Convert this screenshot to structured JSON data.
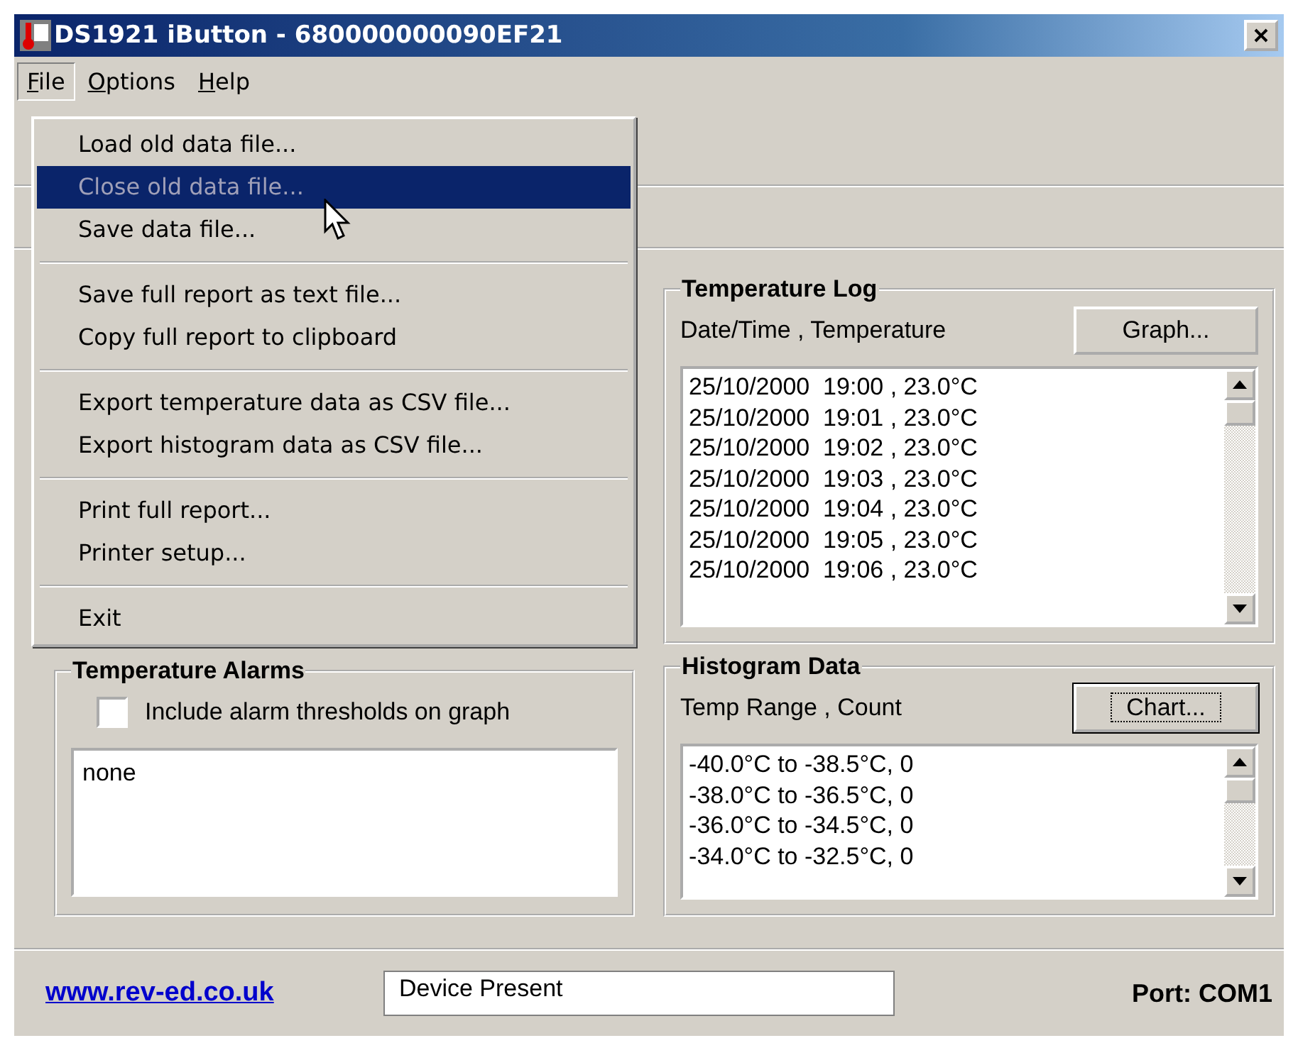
{
  "window": {
    "title": "DS1921 iButton - 680000000090EF21"
  },
  "menu_bar": [
    {
      "label": "File",
      "selected": true
    },
    {
      "label": "Options",
      "selected": false
    },
    {
      "label": "Help",
      "selected": false
    }
  ],
  "file_menu": [
    {
      "kind": "item",
      "label": "Load old data file...",
      "disabled": false,
      "selected": false
    },
    {
      "kind": "item",
      "label": "Close old data file...",
      "disabled": true,
      "selected": true
    },
    {
      "kind": "item",
      "label": "Save data file...",
      "disabled": false,
      "selected": false
    },
    {
      "kind": "separator"
    },
    {
      "kind": "item",
      "label": "Save full report as text file...",
      "disabled": false,
      "selected": false
    },
    {
      "kind": "item",
      "label": "Copy full report to clipboard",
      "disabled": false,
      "selected": false
    },
    {
      "kind": "separator"
    },
    {
      "kind": "item",
      "label": "Export temperature data as CSV file...",
      "disabled": false,
      "selected": false
    },
    {
      "kind": "item",
      "label": "Export histogram data as CSV file...",
      "disabled": false,
      "selected": false
    },
    {
      "kind": "separator"
    },
    {
      "kind": "item",
      "label": "Print full report...",
      "disabled": false,
      "selected": false
    },
    {
      "kind": "item",
      "label": "Printer setup...",
      "disabled": false,
      "selected": false
    },
    {
      "kind": "separator"
    },
    {
      "kind": "item",
      "label": "Exit",
      "disabled": false,
      "selected": false
    }
  ],
  "temperature_alarms": {
    "title": "Temperature Alarms",
    "checkbox": {
      "label": "Include alarm thresholds on graph",
      "checked": false
    },
    "text": "none"
  },
  "temperature_log": {
    "title": "Temperature Log",
    "header": "Date/Time , Temperature",
    "button": {
      "label": "Graph...",
      "focused": false
    },
    "rows": [
      "25/10/2000  19:00 , 23.0°C",
      "25/10/2000  19:01 , 23.0°C",
      "25/10/2000  19:02 , 23.0°C",
      "25/10/2000  19:03 , 23.0°C",
      "25/10/2000  19:04 , 23.0°C",
      "25/10/2000  19:05 , 23.0°C",
      "25/10/2000  19:06 , 23.0°C"
    ]
  },
  "histogram": {
    "title": "Histogram Data",
    "header": "Temp Range , Count",
    "button": {
      "label": "Chart...",
      "focused": true
    },
    "rows": [
      "-40.0°C to -38.5°C, 0",
      "-38.0°C to -36.5°C, 0",
      "-36.0°C to -34.5°C, 0",
      "-34.0°C to -32.5°C, 0"
    ]
  },
  "status_bar": {
    "link": "www.rev-ed.co.uk",
    "status": "Device Present",
    "port": "Port: COM1"
  }
}
